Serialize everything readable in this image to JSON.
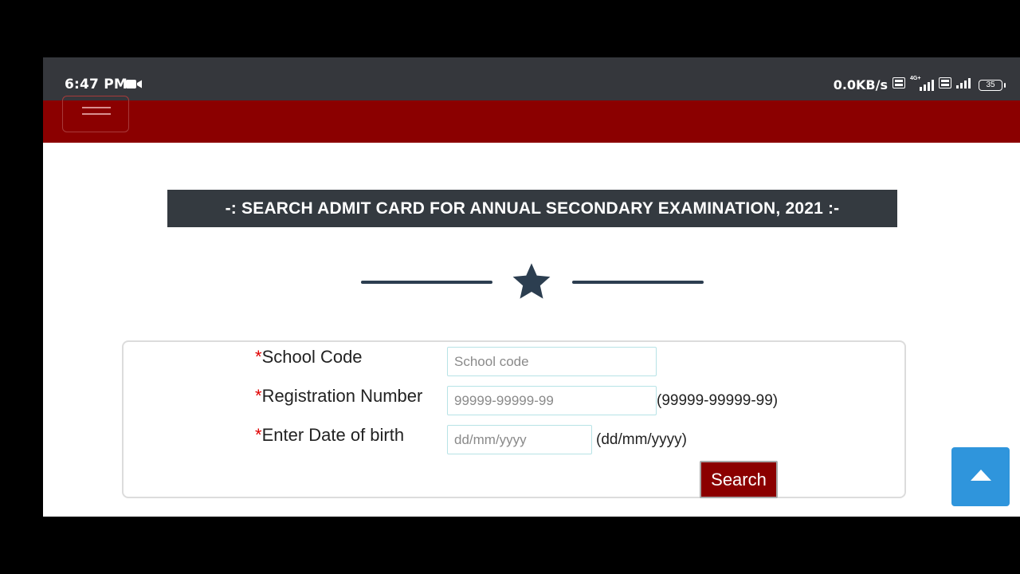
{
  "status_bar": {
    "time": "6:47 PM",
    "net_speed": "0.0KB/s",
    "battery": "35",
    "network_label": "4G+"
  },
  "page": {
    "title": "-: SEARCH ADMIT CARD FOR ANNUAL SECONDARY EXAMINATION, 2021 :-"
  },
  "form": {
    "required_mark": "*",
    "school_code_label": "School Code",
    "school_code_placeholder": "School code",
    "registration_label": "Registration Number",
    "registration_placeholder": "99999-99999-99",
    "registration_hint": "(99999-99999-99)",
    "dob_label": "Enter Date of birth",
    "dob_placeholder": "dd/mm/yyyy",
    "dob_hint": "(dd/mm/yyyy)",
    "search_label": "Search"
  },
  "colors": {
    "navbar": "#8b0000",
    "title_bar": "#343a40",
    "accent_required": "#e00000",
    "scroll_button": "#2f95dc"
  },
  "icons": {
    "menu": "hamburger-icon",
    "divider": "star-icon",
    "scroll_top": "caret-up-icon",
    "camera": "video-camera-icon"
  }
}
